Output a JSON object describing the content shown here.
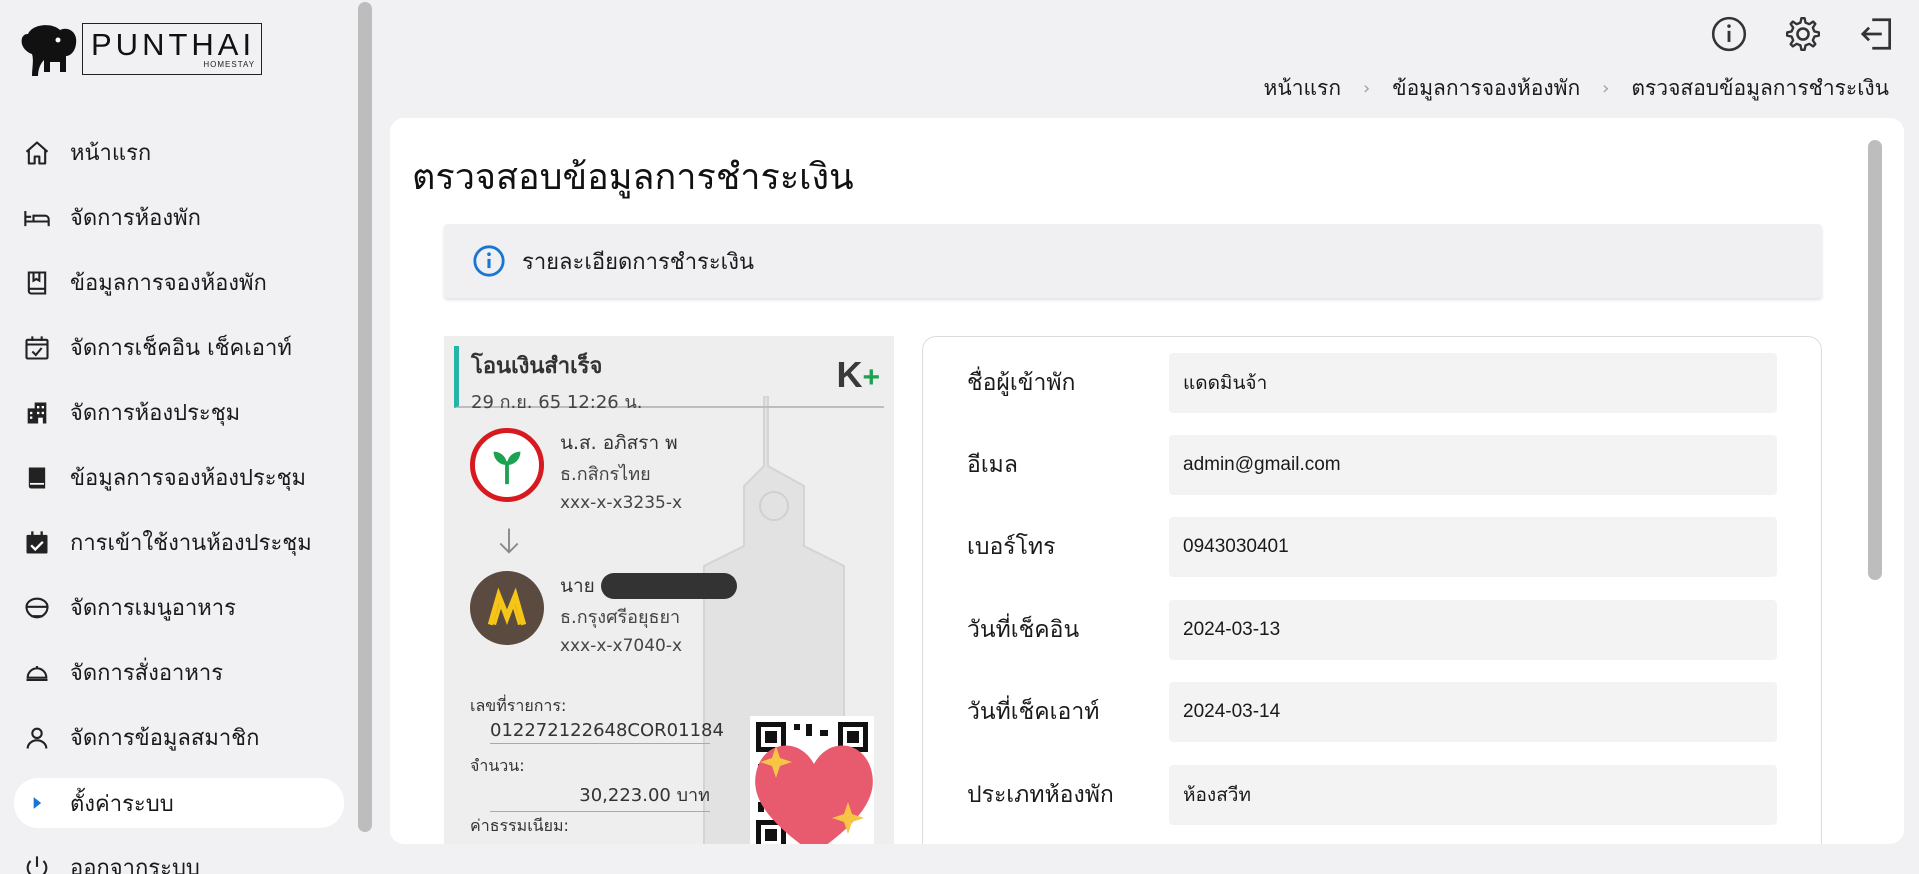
{
  "brand": {
    "name": "PUNTHAI",
    "subtitle": "HOMESTAY"
  },
  "sidebar": {
    "items": [
      {
        "label": "หน้าแรก",
        "icon": "home-icon"
      },
      {
        "label": "จัดการห้องพัก",
        "icon": "bed-icon"
      },
      {
        "label": "ข้อมูลการจองห้องพัก",
        "icon": "book-icon"
      },
      {
        "label": "จัดการเช็คอิน เช็คเอาท์",
        "icon": "calendar-check-icon"
      },
      {
        "label": "จัดการห้องประชุม",
        "icon": "building-icon"
      },
      {
        "label": "ข้อมูลการจองห้องประชุม",
        "icon": "book-filled-icon"
      },
      {
        "label": "การเข้าใช้งานห้องประชุม",
        "icon": "event-available-icon"
      },
      {
        "label": "จัดการเมนูอาหาร",
        "icon": "rice-bowl-icon"
      },
      {
        "label": "จัดการสั่งอาหาร",
        "icon": "room-service-icon"
      },
      {
        "label": "จัดการข้อมูลสมาชิก",
        "icon": "person-icon"
      },
      {
        "label": "ตั้งค่าระบบ",
        "icon": "caret-right-icon"
      },
      {
        "label": "ออกจากระบบ",
        "icon": "power-icon"
      }
    ],
    "active_index": 10
  },
  "topbar": {
    "icons": [
      "info-icon",
      "settings-icon",
      "logout-icon"
    ]
  },
  "breadcrumb": {
    "items": [
      "หน้าแรก",
      "ข้อมูลการจองห้องพัก",
      "ตรวจสอบข้อมูลการชำระเงิน"
    ],
    "separator": "›"
  },
  "page": {
    "title": "ตรวจสอบข้อมูลการชำระเงิน",
    "alert": "รายละเอียดการชำระเงิน"
  },
  "slip": {
    "status": "โอนเงินสำเร็จ",
    "datetime": "29 ก.ย. 65  12:26 น.",
    "brand": "K",
    "brand_plus": "+",
    "sender": {
      "name": "น.ส. อภิสรา พ",
      "bank": "ธ.กสิกรไทย",
      "account": "xxx-x-x3235-x"
    },
    "receiver": {
      "prefix": "นาย",
      "bank": "ธ.กรุงศรีอยุธยา",
      "account": "xxx-x-x7040-x"
    },
    "ref_label": "เลขที่รายการ:",
    "ref_value": "012272122648COR01184",
    "amount_label": "จำนวน:",
    "amount_value": "30,223.00 บาท",
    "fee_label": "ค่าธรรมเนียม:"
  },
  "form": {
    "fields": [
      {
        "label": "ชื่อผู้เข้าพัก",
        "value": "แดดมินจ้า"
      },
      {
        "label": "อีเมล",
        "value": "admin@gmail.com"
      },
      {
        "label": "เบอร์โทร",
        "value": "0943030401"
      },
      {
        "label": "วันที่เช็คอิน",
        "value": "2024-03-13"
      },
      {
        "label": "วันที่เช็คเอาท์",
        "value": "2024-03-14"
      },
      {
        "label": "ประเภทห้องพัก",
        "value": "ห้องสวีท"
      }
    ]
  },
  "colors": {
    "accent": "#1976d2",
    "kbank_green": "#1ba351",
    "slip_bar": "#26b5a5"
  }
}
